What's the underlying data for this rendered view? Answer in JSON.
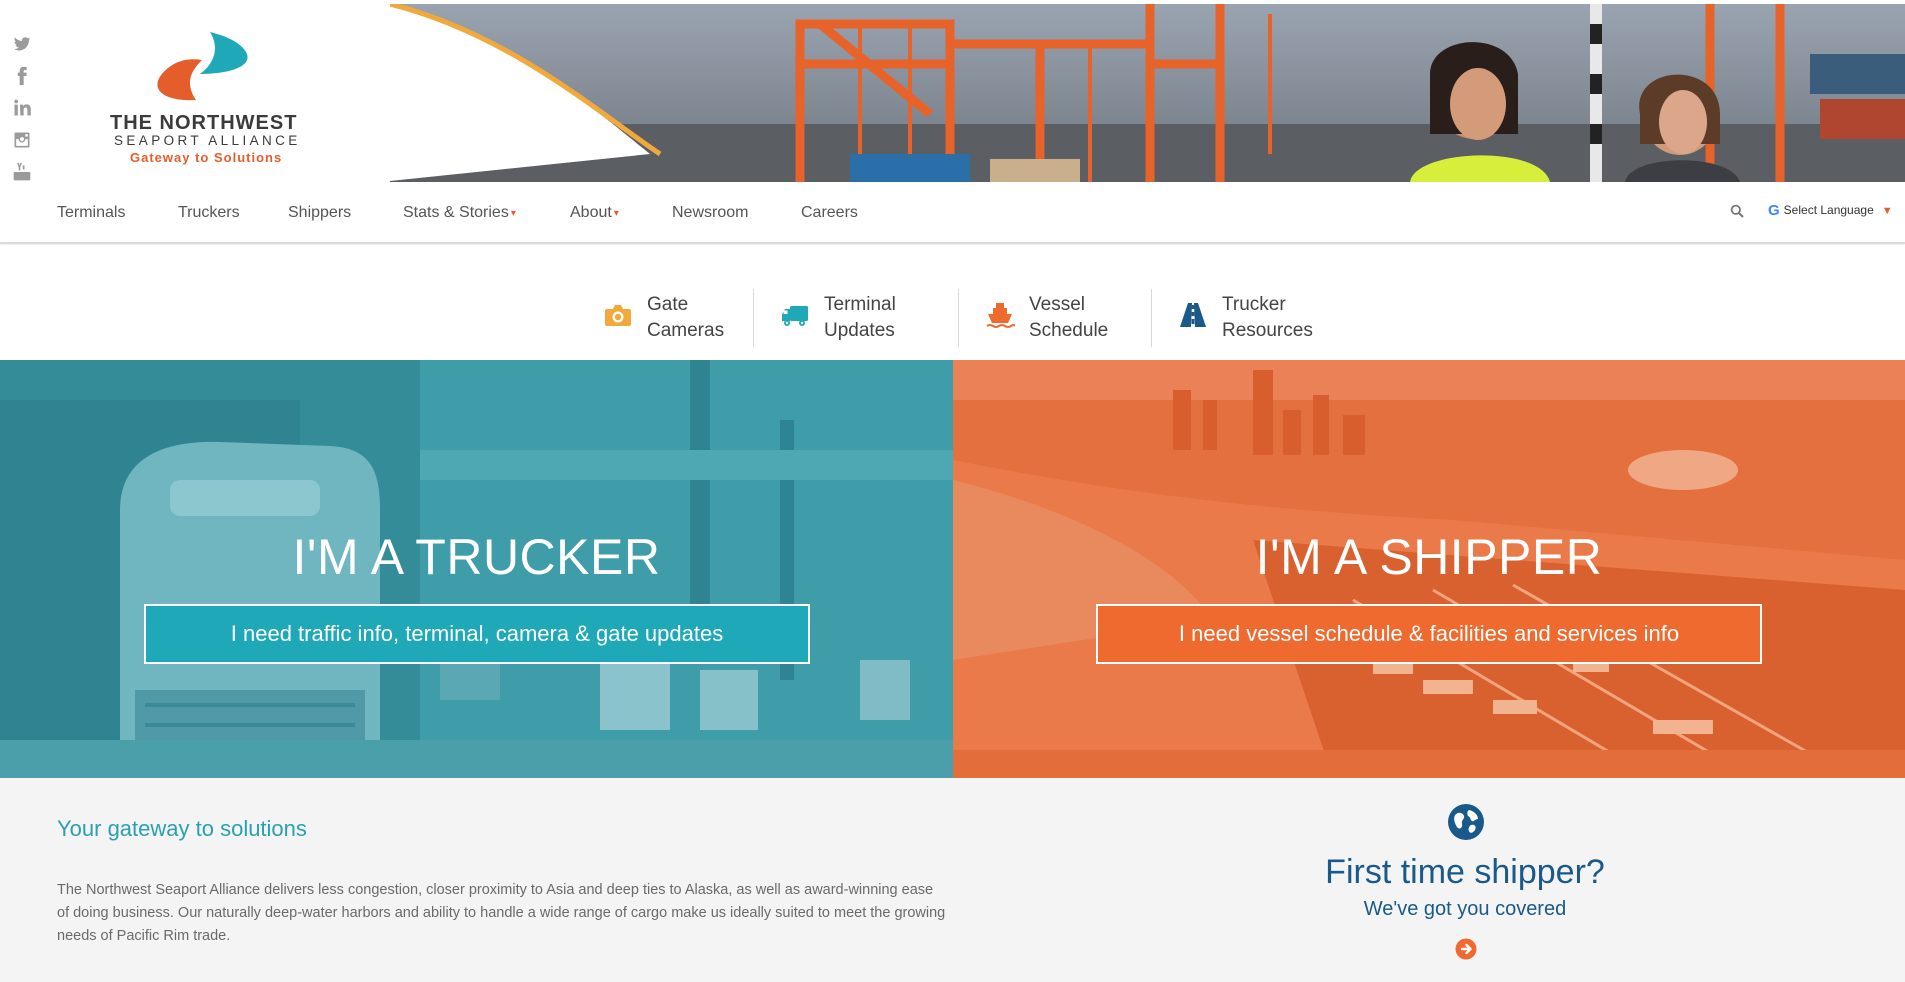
{
  "brand": {
    "name_line1": "THE NORTHWEST",
    "name_line2": "SEAPORT ALLIANCE",
    "tagline": "Gateway to Solutions",
    "colors": {
      "teal": "#1fa9b8",
      "orange": "#ee6a2f",
      "navy": "#1a5a8a"
    }
  },
  "social": [
    "twitter-icon",
    "facebook-icon",
    "linkedin-icon",
    "instagram-icon",
    "youtube-icon"
  ],
  "nav": {
    "items": [
      {
        "label": "Terminals",
        "dropdown": false
      },
      {
        "label": "Truckers",
        "dropdown": false
      },
      {
        "label": "Shippers",
        "dropdown": false
      },
      {
        "label": "Stats & Stories",
        "dropdown": true
      },
      {
        "label": "About",
        "dropdown": true
      },
      {
        "label": "Newsroom",
        "dropdown": false
      },
      {
        "label": "Careers",
        "dropdown": false
      }
    ],
    "caret": "▾",
    "language_label": "Select Language",
    "language_arrow": "▼",
    "google_glyph": "G"
  },
  "quick_links": [
    {
      "line1": "Gate",
      "line2": "Cameras",
      "icon": "camera-icon",
      "color": "#f2a93b"
    },
    {
      "line1": "Terminal",
      "line2": "Updates",
      "icon": "truck-icon",
      "color": "#1fa9b8"
    },
    {
      "line1": "Vessel",
      "line2": "Schedule",
      "icon": "ship-icon",
      "color": "#ee6a2f"
    },
    {
      "line1": "Trucker",
      "line2": "Resources",
      "icon": "road-icon",
      "color": "#1a5a8a"
    }
  ],
  "hero": {
    "trucker": {
      "title": "I'M A TRUCKER",
      "cta": "I need traffic info, terminal, camera & gate updates"
    },
    "shipper": {
      "title": "I'M A SHIPPER",
      "cta": "I need vessel schedule & facilities and services info"
    }
  },
  "gateway": {
    "title": "Your gateway to solutions",
    "body": "The Northwest Seaport Alliance delivers less congestion, closer proximity to Asia and deep ties to Alaska, as well as award-winning ease of doing business. Our naturally deep-water harbors and ability to handle a wide range of cargo make us ideally suited to meet the growing needs of Pacific Rim trade."
  },
  "first_time": {
    "title": "First time shipper?",
    "subtitle": "We've got you covered"
  }
}
